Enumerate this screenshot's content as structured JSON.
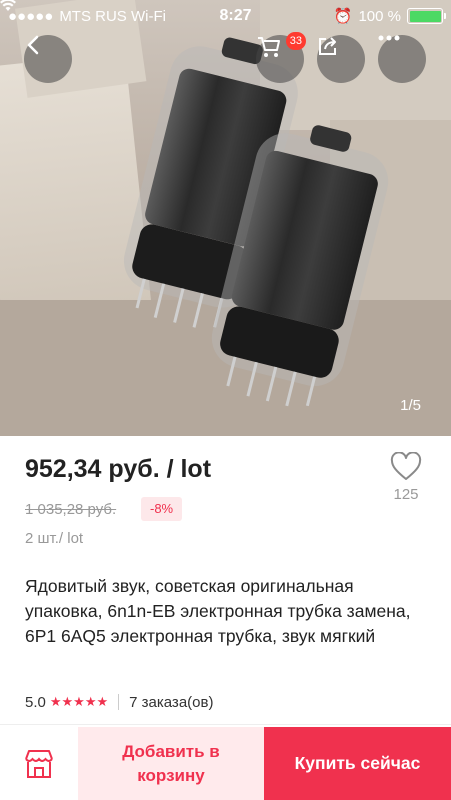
{
  "status_bar": {
    "carrier": "MTS RUS Wi-Fi",
    "time": "8:27",
    "battery": "100 %"
  },
  "gallery": {
    "counter": "1/5",
    "cart_badge": "33"
  },
  "product": {
    "price": "952,34 руб. / lot",
    "old_price": "1 035,28 руб.",
    "discount": "-8%",
    "quantity": "2 шт./ lot",
    "favorites_count": "125",
    "title": "Ядовитый звук, советская оригинальная упаковка, 6n1n-EB электронная трубка замена, 6P1 6AQ5 электронная трубка, звук мягкий",
    "rating": "5.0",
    "stars": "★★★★★",
    "orders": "7 заказа(ов)"
  },
  "actions": {
    "add_to_cart": "Добавить в корзину",
    "buy_now": "Купить сейчас"
  },
  "colors": {
    "accent": "#f0314e",
    "accent_light": "#ffeaec"
  }
}
